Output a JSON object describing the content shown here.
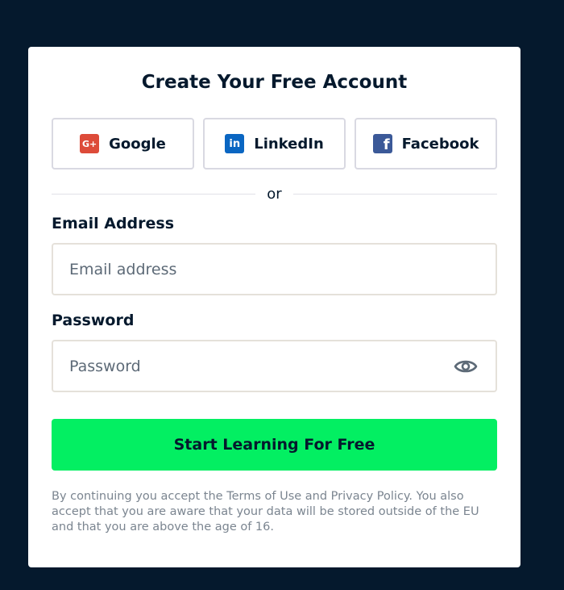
{
  "card": {
    "title": "Create Your Free Account"
  },
  "social": {
    "google": {
      "label": "Google",
      "icon": "google-plus-icon",
      "glyph": "G+",
      "color": "#dd4b39"
    },
    "linkedin": {
      "label": "LinkedIn",
      "icon": "linkedin-icon",
      "glyph": "in",
      "color": "#0a66c2"
    },
    "facebook": {
      "label": "Facebook",
      "icon": "facebook-icon",
      "glyph": "f",
      "color": "#3b5998"
    }
  },
  "divider": {
    "text": "or"
  },
  "email": {
    "label": "Email Address",
    "placeholder": "Email address",
    "value": ""
  },
  "password": {
    "label": "Password",
    "placeholder": "Password",
    "value": "",
    "toggle_icon": "eye-icon"
  },
  "submit": {
    "label": "Start Learning For Free",
    "color": "#03ef62"
  },
  "legal": {
    "text": "By continuing you accept the Terms of Use and Privacy Policy. You also accept that you are aware that your data will be stored outside of the EU and that you are above the age of 16."
  },
  "colors": {
    "background": "#05192d",
    "card": "#ffffff",
    "text": "#05192d",
    "muted": "#7b8590"
  }
}
